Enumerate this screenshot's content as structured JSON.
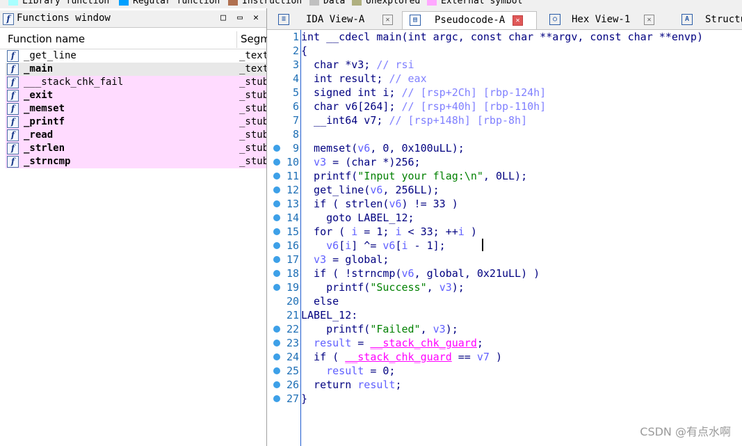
{
  "legend": [
    {
      "label": "Library function",
      "color": "#a8ffff"
    },
    {
      "label": "Regular function",
      "color": "#00a0ff"
    },
    {
      "label": "Instruction",
      "color": "#b07050"
    },
    {
      "label": "Data",
      "color": "#c0c0c0"
    },
    {
      "label": "Unexplored",
      "color": "#b0b080"
    },
    {
      "label": "External symbol",
      "color": "#ffa8ff"
    }
  ],
  "functions_window": {
    "title": "Functions window",
    "col_name": "Function name",
    "col_segment": "Segm",
    "rows": [
      {
        "name": "_get_line",
        "segment": "_text"
      },
      {
        "name": "_main",
        "segment": "_text"
      },
      {
        "name": "___stack_chk_fail",
        "segment": "_stubs"
      },
      {
        "name": "_exit",
        "segment": "_stubs"
      },
      {
        "name": "_memset",
        "segment": "_stubs"
      },
      {
        "name": "_printf",
        "segment": "_stubs"
      },
      {
        "name": "_read",
        "segment": "_stubs"
      },
      {
        "name": "_strlen",
        "segment": "_stubs"
      },
      {
        "name": "_strncmp",
        "segment": "_stubs"
      }
    ]
  },
  "tabs": [
    {
      "label": "IDA View-A",
      "icon": "list-icon"
    },
    {
      "label": "Pseudocode-A",
      "icon": "document-icon"
    },
    {
      "label": "Hex View-1",
      "icon": "hex-icon"
    },
    {
      "label": "Structures",
      "icon": "structure-icon"
    }
  ],
  "code": {
    "line_numbers": [
      "1",
      "2",
      "3",
      "4",
      "5",
      "6",
      "7",
      "8",
      "9",
      "10",
      "11",
      "12",
      "13",
      "14",
      "15",
      "16",
      "17",
      "18",
      "19",
      "20",
      "21",
      "22",
      "23",
      "24",
      "25",
      "26",
      "27"
    ],
    "l1": "int __cdecl main(int argc, const char **argv, const char **envp)",
    "l2": "{",
    "l3a": "  char *v3; ",
    "l3b": "// rsi",
    "l4a": "  int result; ",
    "l4b": "// eax",
    "l5a": "  signed int i; ",
    "l5b": "// [rsp+2Ch] [rbp-124h]",
    "l6a": "  char v6[264]; ",
    "l6b": "// [rsp+40h] [rbp-110h]",
    "l7a": "  __int64 v7; ",
    "l7b": "// [rsp+148h] [rbp-8h]",
    "l9a": "  memset(",
    "l9b": "v6",
    "l9c": ", 0, 0x100uLL);",
    "l10a": "  v3",
    "l10b": " = (char *)256;",
    "l11a": "  printf(",
    "l11b": "\"Input your flag:\\n\"",
    "l11c": ", 0LL);",
    "l12a": "  get_line(",
    "l12b": "v6",
    "l12c": ", 256LL);",
    "l13a": "  if ( strlen(",
    "l13b": "v6",
    "l13c": ") != 33 )",
    "l14": "    goto LABEL_12;",
    "l15a": "  for ( ",
    "l15b": "i",
    "l15c": " = 1; ",
    "l15d": "i",
    "l15e": " < 33; ++",
    "l15f": "i",
    "l15g": " )",
    "l16a": "    ",
    "l16b": "v6",
    "l16c": "[",
    "l16d": "i",
    "l16e": "] ^= ",
    "l16f": "v6",
    "l16g": "[",
    "l16h": "i",
    "l16i": " - 1];",
    "l17a": "  v3",
    "l17b": " = ",
    "l17c": "global",
    "l17d": ";",
    "l18a": "  if ( !strncmp(",
    "l18b": "v6",
    "l18c": ", ",
    "l18d": "global",
    "l18e": ", 0x21uLL) )",
    "l19a": "    printf(",
    "l19b": "\"Success\"",
    "l19c": ", ",
    "l19d": "v3",
    "l19e": ");",
    "l20": "  else",
    "l21": "LABEL_12:",
    "l22a": "    printf(",
    "l22b": "\"Failed\"",
    "l22c": ", ",
    "l22d": "v3",
    "l22e": ");",
    "l23a": "  result",
    "l23b": " = ",
    "l23c": "__stack_chk_guard",
    "l23d": ";",
    "l24a": "  if ( ",
    "l24b": "__stack_chk_guard",
    "l24c": " == ",
    "l24d": "v7",
    "l24e": " )",
    "l25a": "    result",
    "l25b": " = 0;",
    "l26a": "  return ",
    "l26b": "result",
    "l26c": ";",
    "l27": "}"
  },
  "watermark": "CSDN @有点水啊"
}
